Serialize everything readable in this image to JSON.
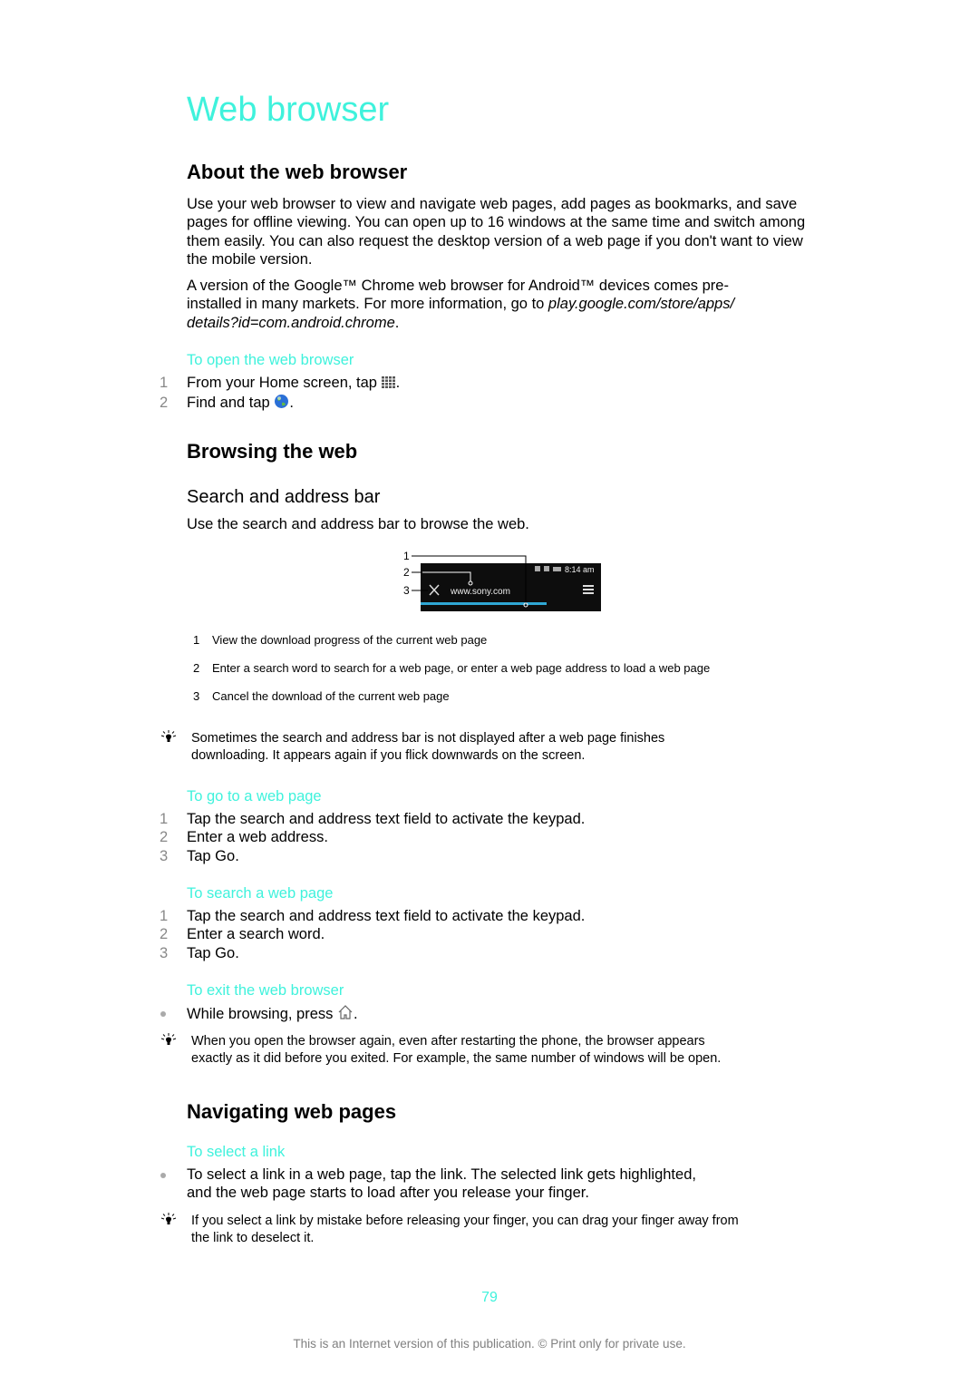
{
  "page": {
    "title": "Web browser",
    "page_number": "79",
    "footer": "This is an Internet version of this publication. © Print only for private use.",
    "accent_color": "#3ff2dc"
  },
  "about": {
    "heading": "About the web browser",
    "para1": "Use your web browser to view and navigate web pages, add pages as bookmarks, and save pages for offline viewing. You can open up to 16 windows at the same time and switch among them easily. You can also request the desktop version of a web page if you don't want to view the mobile version.",
    "para2_lines": [
      "A version of the Google™ Chrome web browser for Android™ devices comes pre-",
      "installed in many markets. For more information, go to "
    ],
    "para2_link_a": "play.google.com/store/apps/",
    "para2_link_b": "details?id=com.android.chrome",
    "para2_end": "."
  },
  "open_browser": {
    "heading": "To open the web browser",
    "steps": [
      {
        "num": "1",
        "text": "From your Home screen, tap ",
        "icon": "apps-grid-icon",
        "after": "."
      },
      {
        "num": "2",
        "text": "Find and tap ",
        "icon": "globe-browser-icon",
        "after": "."
      }
    ]
  },
  "browsing": {
    "heading": "Browsing the web",
    "sub_heading": "Search and address bar",
    "intro": "Use the search and address bar to browse the web.",
    "figure": {
      "callouts": [
        "1",
        "2",
        "3"
      ],
      "url": "www.sony.com",
      "time": "8:14 am",
      "progress_fraction": 0.7
    },
    "legend": [
      {
        "num": "1",
        "text": "View the download progress of the current web page"
      },
      {
        "num": "2",
        "text": "Enter a search word to search for a web page, or enter a web page address to load a web page"
      },
      {
        "num": "3",
        "text": "Cancel the download of the current web page"
      }
    ],
    "tip1_lines": [
      "Sometimes the search and address bar is not displayed after a web page finishes",
      "downloading. It appears again if you flick downwards on the screen."
    ]
  },
  "go_to_page": {
    "heading": "To go to a web page",
    "steps": [
      {
        "num": "1",
        "text": "Tap the search and address text field to activate the keypad."
      },
      {
        "num": "2",
        "text": "Enter a web address."
      },
      {
        "num": "3",
        "text": "Tap Go."
      }
    ]
  },
  "search_page": {
    "heading": "To search a web page",
    "steps": [
      {
        "num": "1",
        "text": "Tap the search and address text field to activate the keypad."
      },
      {
        "num": "2",
        "text": "Enter a search word."
      },
      {
        "num": "3",
        "text": "Tap Go."
      }
    ]
  },
  "exit_browser": {
    "heading": "To exit the web browser",
    "bullet_text": "While browsing, press ",
    "bullet_icon": "home-icon",
    "bullet_after": ".",
    "tip_lines": [
      "When you open the browser again, even after restarting the phone, the browser appears",
      "exactly as it did before you exited. For example, the same number of windows will be open."
    ]
  },
  "navigating": {
    "heading": "Navigating web pages",
    "procedure": "To select a link",
    "bullet_lines": [
      "To select a link in a web page, tap the link. The selected link gets highlighted,",
      "and the web page starts to load after you release your finger."
    ],
    "tip_lines": [
      "If you select a link by mistake before releasing your finger, you can drag your finger away from",
      "the link to deselect it."
    ]
  }
}
